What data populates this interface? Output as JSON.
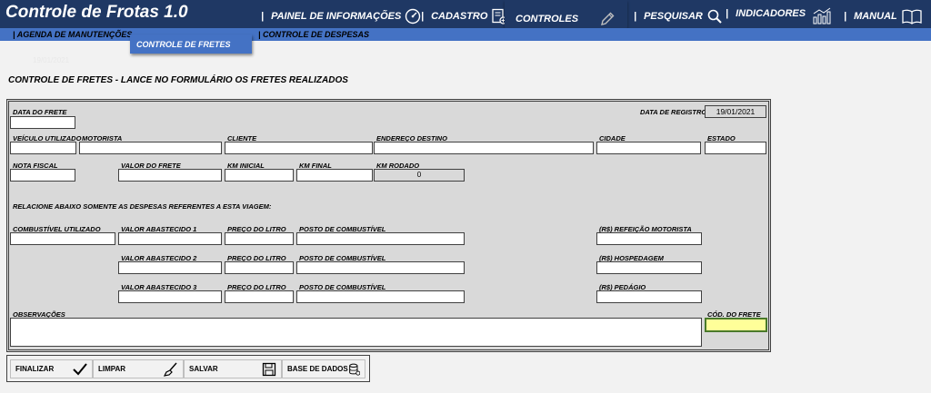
{
  "app": {
    "title": "Controle de Frotas 1.0"
  },
  "nav": {
    "painel": "PAINEL DE INFORMAÇÕES",
    "cadastro": "CADASTRO",
    "controles": "CONTROLES",
    "pesquisar": "PESQUISAR",
    "indicadores": "INDICADORES",
    "manual": "MANUAL",
    "separator": "|"
  },
  "subnav": {
    "agenda": "AGENDA DE MANUTENÇÕES",
    "fretes": "CONTROLE DE FRETES",
    "despesas": "CONTROLE DE DESPESAS",
    "separator": "|"
  },
  "faint_date": "19/01/2021",
  "page_heading": "CONTROLE DE FRETES - LANCE NO FORMULÁRIO OS FRETES REALIZADOS",
  "form": {
    "data_frete": {
      "label": "DATA DO FRETE",
      "value": ""
    },
    "data_registro": {
      "label": "DATA DE REGISTRO:",
      "value": "19/01/2021"
    },
    "veiculo": {
      "label": "VEÍCULO UTILIZADO",
      "value": ""
    },
    "motorista": {
      "label": "MOTORISTA",
      "value": ""
    },
    "cliente": {
      "label": "CLIENTE",
      "value": ""
    },
    "endereco": {
      "label": "ENDEREÇO DESTINO",
      "value": ""
    },
    "cidade": {
      "label": "CIDADE",
      "value": ""
    },
    "estado": {
      "label": "ESTADO",
      "value": ""
    },
    "nota_fiscal": {
      "label": "NOTA FISCAL",
      "value": ""
    },
    "valor_frete": {
      "label": "VALOR DO FRETE",
      "value": ""
    },
    "km_inicial": {
      "label": "KM INICIAL",
      "value": ""
    },
    "km_final": {
      "label": "KM FINAL",
      "value": ""
    },
    "km_rodado": {
      "label": "KM RODADO",
      "value": "0"
    },
    "despesas_note": "RELACIONE ABAIXO SOMENTE AS DESPESAS REFERENTES A ESTA VIAGEM:",
    "combustivel": {
      "label": "COMBUSTÍVEL UTILIZADO",
      "value": ""
    },
    "abastecimentos": [
      {
        "valor_label": "VALOR ABASTECIDO 1",
        "preco_label": "PREÇO DO LITRO",
        "posto_label": "POSTO DE COMBUSTÍVEL",
        "extra_label": "(R$) REFEIÇÃO MOTORISTA"
      },
      {
        "valor_label": "VALOR ABASTECIDO 2",
        "preco_label": "PREÇO DO LITRO",
        "posto_label": "POSTO DE COMBUSTÍVEL",
        "extra_label": "(R$) HOSPEDAGEM"
      },
      {
        "valor_label": "VALOR ABASTECIDO 3",
        "preco_label": "PREÇO DO LITRO",
        "posto_label": "POSTO DE COMBUSTÍVEL",
        "extra_label": "(R$) PEDÁGIO"
      }
    ],
    "observacoes": {
      "label": "OBSERVAÇÕES",
      "value": ""
    },
    "cod_frete": {
      "label": "CÓD. DO FRETE",
      "value": ""
    }
  },
  "buttons": {
    "finalizar": "FINALIZAR",
    "limpar": "LIMPAR",
    "salvar": "SALVAR",
    "base_dados": "BASE DE DADOS"
  },
  "icons": {
    "painel": "gauge-icon",
    "cadastro": "add-document-icon",
    "controles": "pencil-icon",
    "pesquisar": "search-icon",
    "indicadores": "bar-chart-icon",
    "manual": "open-book-icon",
    "finalizar": "checkmark-icon",
    "limpar": "broom-icon",
    "salvar": "floppy-disk-icon",
    "base_dados": "database-icon"
  },
  "colors": {
    "topbar": "#1f3864",
    "subbar": "#4472c4",
    "form_bg": "#d9d9d9",
    "highlight_field": "#ffff99"
  }
}
